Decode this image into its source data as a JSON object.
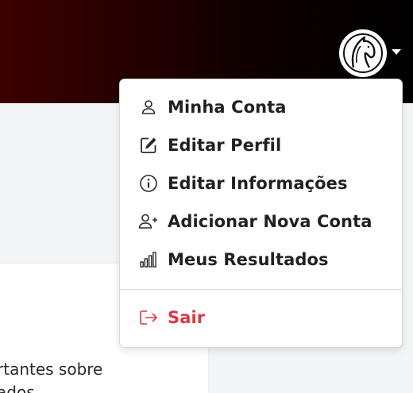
{
  "user_menu": {
    "items": [
      {
        "label": "Minha Conta"
      },
      {
        "label": "Editar Perfil"
      },
      {
        "label": "Editar Informações"
      },
      {
        "label": "Adicionar Nova Conta"
      },
      {
        "label": "Meus Resultados"
      }
    ],
    "logout_label": "Sair"
  },
  "content": {
    "text_line1": "rtantes sobre",
    "text_line2": "ados"
  },
  "colors": {
    "header_start": "#3d0000",
    "header_end": "#000000",
    "logout": "#dc3545",
    "menu_text": "#1f2124"
  },
  "icons": {
    "avatar": "horse-head-logo",
    "account": "user-icon",
    "edit_profile": "edit-square-icon",
    "edit_info": "info-circle-icon",
    "add_account": "user-plus-icon",
    "results": "bar-chart-icon",
    "logout": "logout-icon",
    "menu_toggle": "caret-down-icon"
  }
}
